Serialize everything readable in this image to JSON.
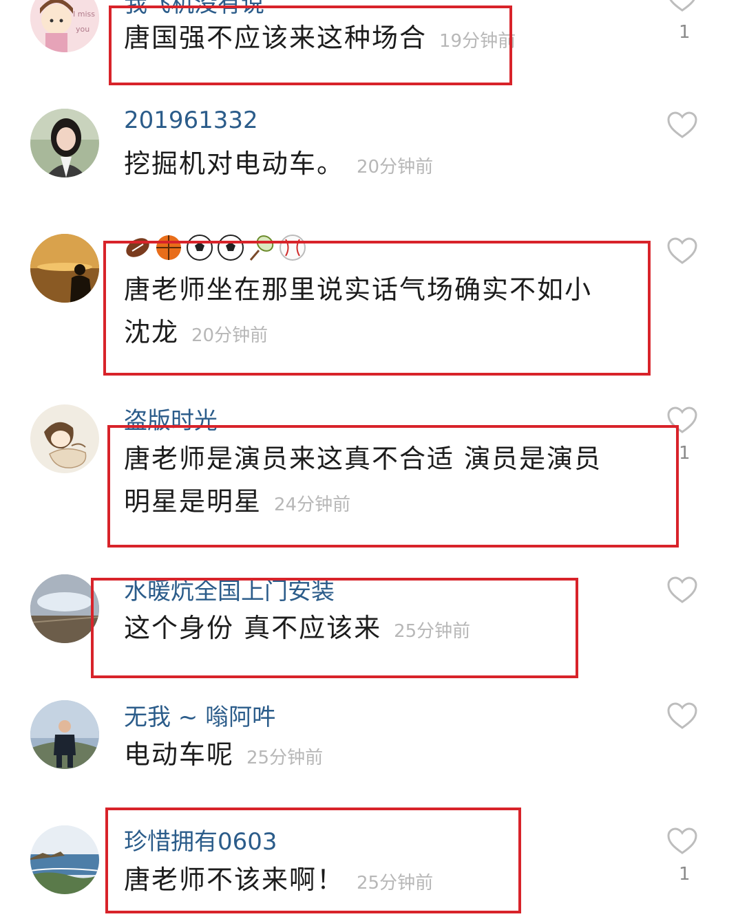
{
  "comments": [
    {
      "username": "我飞机没有说",
      "text": "唐国强不应该来这种场合",
      "time": "19分钟前",
      "likes": "1"
    },
    {
      "username": "201961332",
      "text": "挖掘机对电动车。",
      "time": "20分钟前",
      "likes": ""
    },
    {
      "username": "",
      "text_line1": "唐老师坐在那里说实话气场确实不如小",
      "text_line2": "沈龙",
      "time": "20分钟前",
      "likes": ""
    },
    {
      "username": "盗版时光",
      "text_line1": "唐老师是演员来这真不合适 演员是演员",
      "text_line2": "明星是明星",
      "time": "24分钟前",
      "likes": "1"
    },
    {
      "username": "水暖炕全国上门安装",
      "text": "这个身份 真不应该来",
      "time": "25分钟前",
      "likes": ""
    },
    {
      "username": "无我 ~ 嗡阿吽",
      "text": "电动车呢",
      "time": "25分钟前",
      "likes": ""
    },
    {
      "username": "珍惜拥有0603",
      "text": "唐老师不该来啊！",
      "time": "25分钟前",
      "likes": "1"
    }
  ],
  "avatar_texts": {
    "c1_line1": "I miss",
    "c1_line2": "you"
  },
  "colors": {
    "highlight": "#d8232a",
    "username": "#2b5c8a",
    "time": "#b7b7b7"
  }
}
